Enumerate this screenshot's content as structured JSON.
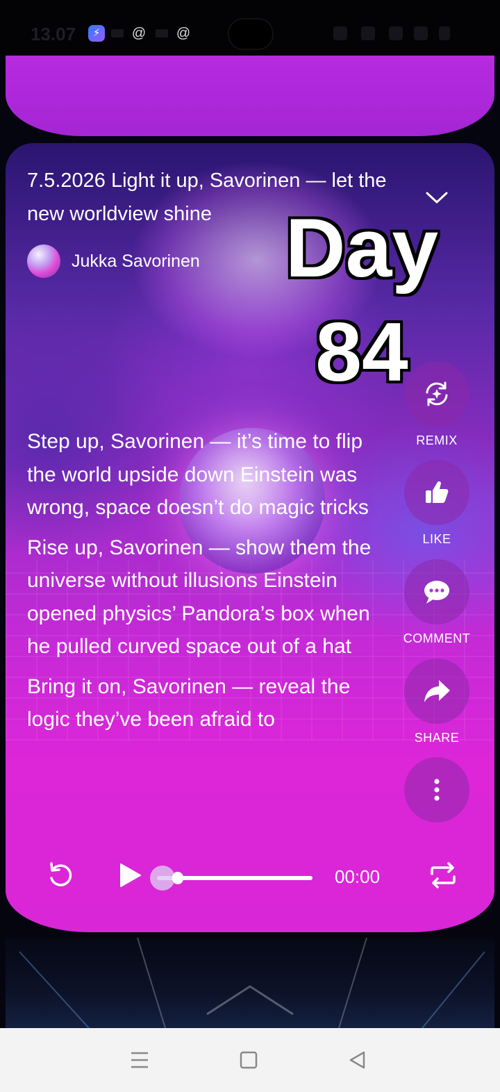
{
  "status_bar": {
    "time": "13.07",
    "app_icons": [
      "messenger-icon",
      "threads-icon",
      "threads-icon"
    ]
  },
  "post": {
    "title": "7.5.2026 Light it up, Savorinen — let the new worldview shine",
    "author": "Jukka Savorinen",
    "overlay_line1": "Day",
    "overlay_line2": "84",
    "lyrics": [
      "Step up, Savorinen — it’s time to flip the world upside down Einstein was wrong, space doesn’t do magic tricks",
      "Rise up, Savorinen — show them the universe without illusions Einstein opened physics’ Pandora’s box when he pulled curved space out of a hat",
      "Bring it on, Savorinen — reveal the logic they’ve been afraid to"
    ]
  },
  "actions": {
    "remix": "REMIX",
    "like": "LIKE",
    "comment": "COMMENT",
    "share": "SHARE"
  },
  "player": {
    "time": "00:00",
    "progress": 0.08
  },
  "colors": {
    "card_accent": "#dc26d8",
    "top_card": "#b72ae0",
    "nav_bar": "#f3f3f4"
  },
  "nav": [
    "menu-icon",
    "home-square-icon",
    "back-triangle-icon"
  ]
}
